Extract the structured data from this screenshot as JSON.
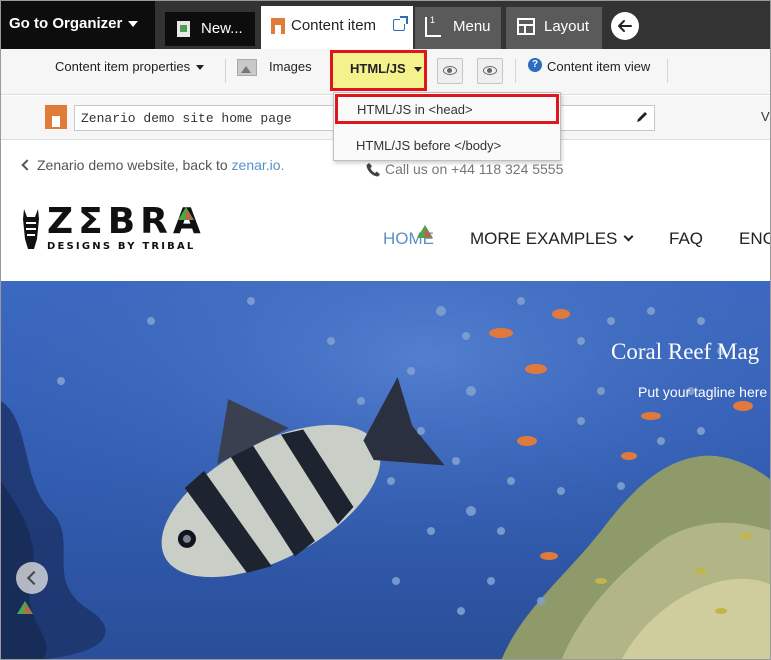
{
  "topbar": {
    "organizer_label": "Go to Organizer",
    "tabs": [
      {
        "label": "New..."
      },
      {
        "label": "Content item"
      },
      {
        "label": "Menu"
      },
      {
        "label": "Layout"
      }
    ]
  },
  "toolbar": {
    "properties_label": "Content item properties",
    "images_label": "Images",
    "htmljs_label": "HTML/JS",
    "view_label": "Content item view"
  },
  "title_row": {
    "title_value": "Zenario demo site home page",
    "cut_text": "V"
  },
  "dropdown": {
    "items": [
      {
        "label": "HTML/JS in <head>"
      },
      {
        "label": "HTML/JS before </body>"
      }
    ]
  },
  "site": {
    "backlink_text": "Zenario demo website, back to ",
    "backlink_link": "zenar.io.",
    "callus_text": "Call us on +44 118 324 5555",
    "logo_word": "ZΣBRA",
    "logo_sub": "DESIGNS BY TRIBAL",
    "nav": [
      {
        "label": "HOME"
      },
      {
        "label": "MORE EXAMPLES"
      },
      {
        "label": "FAQ"
      },
      {
        "label": "ENC"
      }
    ],
    "hero_title": "Coral Reef Mag",
    "hero_tagline": "Put your tagline here"
  },
  "colors": {
    "highlight_red": "#e0161d",
    "htmljs_yellow": "#f5f28d",
    "link_blue": "#5b8fc9",
    "topbar_dark": "#333333"
  }
}
